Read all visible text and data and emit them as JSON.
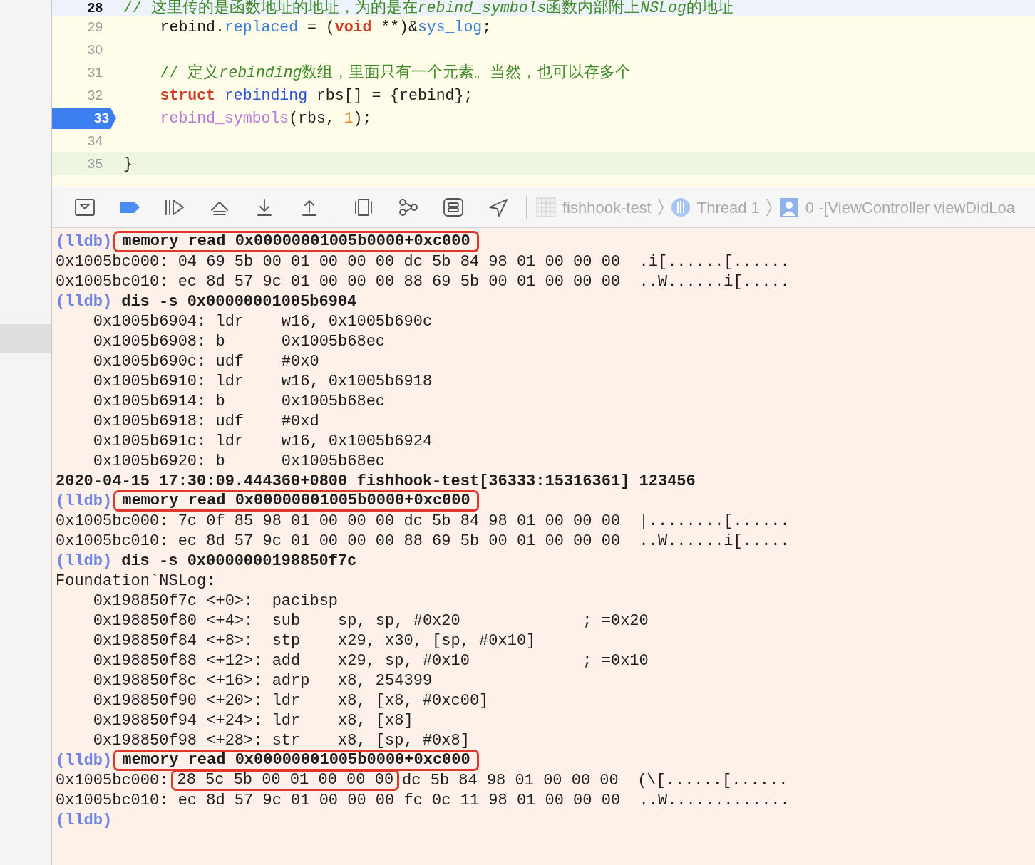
{
  "editor": {
    "lines": [
      {
        "number": "28",
        "current": true,
        "changed": false,
        "breakpoint": false,
        "tokens": [
          {
            "kind": "comment",
            "text": "// 这里传的是函数地址的地址，为的是在"
          },
          {
            "kind": "comment_italic",
            "text": "rebind_symbols"
          },
          {
            "kind": "comment",
            "text": "函数内部附上"
          },
          {
            "kind": "comment_italic",
            "text": "NSLog"
          },
          {
            "kind": "comment",
            "text": "的地址"
          }
        ]
      },
      {
        "number": "29",
        "current": false,
        "changed": false,
        "breakpoint": false,
        "tokens": [
          {
            "kind": "plain",
            "text": "    rebind."
          },
          {
            "kind": "member",
            "text": "replaced"
          },
          {
            "kind": "plain",
            "text": " = ("
          },
          {
            "kind": "keyword",
            "text": "void"
          },
          {
            "kind": "plain",
            "text": " **)&"
          },
          {
            "kind": "member",
            "text": "sys_log"
          },
          {
            "kind": "plain",
            "text": ";"
          }
        ]
      },
      {
        "number": "30",
        "current": false,
        "changed": false,
        "breakpoint": false
      },
      {
        "number": "31",
        "current": false,
        "changed": false,
        "breakpoint": false,
        "tokens": [
          {
            "kind": "comment",
            "text": "    // 定义"
          },
          {
            "kind": "comment_italic",
            "text": "rebinding"
          },
          {
            "kind": "comment",
            "text": "数组，里面只有一个元素。当然，也可以存多个"
          }
        ]
      },
      {
        "number": "32",
        "current": false,
        "changed": false,
        "breakpoint": false,
        "tokens": [
          {
            "kind": "keyword",
            "text": "    struct"
          },
          {
            "kind": "type",
            "text": " rebinding"
          },
          {
            "kind": "plain",
            "text": " rbs[] = {rebind};"
          }
        ]
      },
      {
        "number": "33",
        "current": false,
        "changed": false,
        "breakpoint": true,
        "tokens": [
          {
            "kind": "function",
            "text": "    rebind_symbols"
          },
          {
            "kind": "plain",
            "text": "(rbs, "
          },
          {
            "kind": "number",
            "text": "1"
          },
          {
            "kind": "plain",
            "text": ");"
          }
        ]
      },
      {
        "number": "34",
        "current": false,
        "changed": false,
        "breakpoint": false
      },
      {
        "number": "35",
        "current": false,
        "changed": true,
        "breakpoint": false,
        "tokens": [
          {
            "kind": "plain",
            "text": "}"
          }
        ]
      }
    ]
  },
  "debug_bar": {
    "breadcrumbs": [
      {
        "kind": "project",
        "label": "fishhook-test"
      },
      {
        "kind": "thread",
        "label": "Thread 1"
      },
      {
        "kind": "frame",
        "label": "0 -[ViewController viewDidLoa"
      }
    ]
  },
  "console": {
    "lines": [
      {
        "kind": "command",
        "prompt": "(lldb)",
        "text": "memory read 0x00000001005b0000+0xc000",
        "boxed": true
      },
      {
        "kind": "output",
        "text": "0x1005bc000: 04 69 5b 00 01 00 00 00 dc 5b 84 98 01 00 00 00  .i[......[......"
      },
      {
        "kind": "output",
        "text": "0x1005bc010: ec 8d 57 9c 01 00 00 00 88 69 5b 00 01 00 00 00  ..W......i[....."
      },
      {
        "kind": "command",
        "prompt": "(lldb)",
        "text": "dis -s 0x00000001005b6904",
        "boxed": false
      },
      {
        "kind": "output",
        "text": "    0x1005b6904: ldr    w16, 0x1005b690c"
      },
      {
        "kind": "output",
        "text": "    0x1005b6908: b      0x1005b68ec"
      },
      {
        "kind": "output",
        "text": "    0x1005b690c: udf    #0x0"
      },
      {
        "kind": "output",
        "text": "    0x1005b6910: ldr    w16, 0x1005b6918"
      },
      {
        "kind": "output",
        "text": "    0x1005b6914: b      0x1005b68ec"
      },
      {
        "kind": "output",
        "text": "    0x1005b6918: udf    #0xd"
      },
      {
        "kind": "output",
        "text": "    0x1005b691c: ldr    w16, 0x1005b6924"
      },
      {
        "kind": "output",
        "text": "    0x1005b6920: b      0x1005b68ec"
      },
      {
        "kind": "log",
        "text": "2020-04-15 17:30:09.444360+0800 fishhook-test[36333:15316361] 123456"
      },
      {
        "kind": "command",
        "prompt": "(lldb)",
        "text": "memory read 0x00000001005b0000+0xc000",
        "boxed": true
      },
      {
        "kind": "output",
        "text": "0x1005bc000: 7c 0f 85 98 01 00 00 00 dc 5b 84 98 01 00 00 00  |........[......"
      },
      {
        "kind": "output",
        "text": "0x1005bc010: ec 8d 57 9c 01 00 00 00 88 69 5b 00 01 00 00 00  ..W......i[....."
      },
      {
        "kind": "command",
        "prompt": "(lldb)",
        "text": "dis -s 0x0000000198850f7c",
        "boxed": false
      },
      {
        "kind": "output",
        "text": "Foundation`NSLog:"
      },
      {
        "kind": "output",
        "text": "    0x198850f7c <+0>:  pacibsp"
      },
      {
        "kind": "output",
        "text": "    0x198850f80 <+4>:  sub    sp, sp, #0x20             ; =0x20"
      },
      {
        "kind": "output",
        "text": "    0x198850f84 <+8>:  stp    x29, x30, [sp, #0x10]"
      },
      {
        "kind": "output",
        "text": "    0x198850f88 <+12>: add    x29, sp, #0x10            ; =0x10"
      },
      {
        "kind": "output",
        "text": "    0x198850f8c <+16>: adrp   x8, 254399"
      },
      {
        "kind": "output",
        "text": "    0x198850f90 <+20>: ldr    x8, [x8, #0xc00]"
      },
      {
        "kind": "output",
        "text": "    0x198850f94 <+24>: ldr    x8, [x8]"
      },
      {
        "kind": "output",
        "text": "    0x198850f98 <+28>: str    x8, [sp, #0x8]"
      },
      {
        "kind": "command",
        "prompt": "(lldb)",
        "text": "memory read 0x00000001005b0000+0xc000",
        "boxed": true
      },
      {
        "kind": "segmented",
        "segments": [
          {
            "text": "0x1005bc000:",
            "boxed": false
          },
          {
            "text": "28 5c 5b 00 01 00 00 00",
            "boxed": true
          },
          {
            "text": "dc 5b 84 98 01 00 00 00  (\\[......[......",
            "boxed": false
          }
        ]
      },
      {
        "kind": "output",
        "text": "0x1005bc010: ec 8d 57 9c 01 00 00 00 fc 0c 11 98 01 00 00 00  ..W............."
      },
      {
        "kind": "prompt",
        "prompt": "(lldb)"
      }
    ]
  }
}
